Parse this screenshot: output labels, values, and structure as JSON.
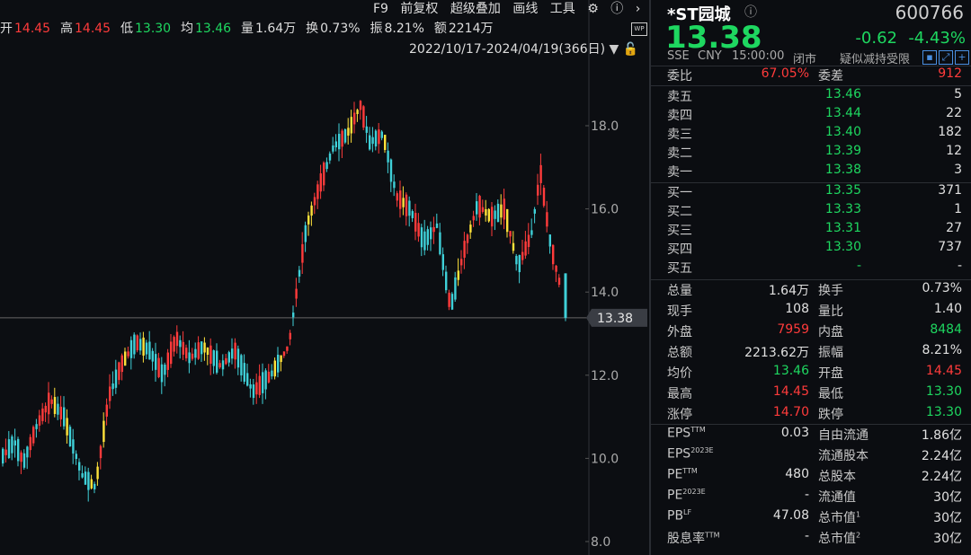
{
  "ohlc": {
    "open_label": "开",
    "open_value": "14.45",
    "high_label": "高",
    "high_value": "14.45",
    "low_label": "低",
    "low_value": "13.30",
    "avg_label": "均",
    "avg_value": "13.46",
    "volume_label": "量",
    "volume_value": "1.64万",
    "turnover_label": "换",
    "turnover_value": "0.73%",
    "amplitude_label": "振",
    "amplitude_value": "8.21%",
    "amount_label": "额",
    "amount_value": "2214万"
  },
  "menu": [
    "F9",
    "前复权",
    "超级叠加",
    "画线",
    "工具"
  ],
  "date_range": "2022/10/17-2024/04/19(366日)",
  "axis_ticks": [
    "18.0",
    "16.0",
    "14.0",
    "12.0",
    "10.0",
    "8.0"
  ],
  "current_price_label": "13.38",
  "stock": {
    "name": "*ST园城",
    "code": "600766",
    "price": "13.38",
    "change": "-0.62",
    "change_pct": "-4.43%",
    "exchange": "SSE",
    "currency": "CNY",
    "time": "15:00:00",
    "status": "闭市",
    "note": "疑似减持受限"
  },
  "committee": {
    "ratio_label": "委比",
    "ratio_value": "67.05%",
    "diff_label": "委差",
    "diff_value": "912"
  },
  "asks": [
    {
      "label": "卖五",
      "price": "13.46",
      "vol": "5"
    },
    {
      "label": "卖四",
      "price": "13.44",
      "vol": "22"
    },
    {
      "label": "卖三",
      "price": "13.40",
      "vol": "182"
    },
    {
      "label": "卖二",
      "price": "13.39",
      "vol": "12"
    },
    {
      "label": "卖一",
      "price": "13.38",
      "vol": "3"
    }
  ],
  "bids": [
    {
      "label": "买一",
      "price": "13.35",
      "vol": "371"
    },
    {
      "label": "买二",
      "price": "13.33",
      "vol": "1"
    },
    {
      "label": "买三",
      "price": "13.31",
      "vol": "27"
    },
    {
      "label": "买四",
      "price": "13.30",
      "vol": "737"
    },
    {
      "label": "买五",
      "price": "-",
      "vol": "-"
    }
  ],
  "stats": [
    {
      "l1": "总量",
      "v1": "1.64万",
      "c1": "white",
      "l2": "换手",
      "v2": "0.73%",
      "c2": "white"
    },
    {
      "l1": "现手",
      "v1": "108",
      "c1": "white",
      "l2": "量比",
      "v2": "1.40",
      "c2": "white"
    },
    {
      "l1": "外盘",
      "v1": "7959",
      "c1": "red",
      "l2": "内盘",
      "v2": "8484",
      "c2": "green"
    },
    {
      "l1": "总额",
      "v1": "2213.62万",
      "c1": "white",
      "l2": "振幅",
      "v2": "8.21%",
      "c2": "white"
    },
    {
      "l1": "均价",
      "v1": "13.46",
      "c1": "green",
      "l2": "开盘",
      "v2": "14.45",
      "c2": "red"
    },
    {
      "l1": "最高",
      "v1": "14.45",
      "c1": "red",
      "l2": "最低",
      "v2": "13.30",
      "c2": "green"
    },
    {
      "l1": "涨停",
      "v1": "14.70",
      "c1": "red",
      "l2": "跌停",
      "v2": "13.30",
      "c2": "green"
    }
  ],
  "fundamentals": [
    {
      "l1": "EPS",
      "s1": "TTM",
      "v1": "0.03",
      "l2": "自由流通",
      "s2": "",
      "v2": "1.86亿"
    },
    {
      "l1": "EPS",
      "s1": "2023E",
      "v1": "",
      "l2": "流通股本",
      "s2": "",
      "v2": "2.24亿"
    },
    {
      "l1": "PE",
      "s1": "TTM",
      "v1": "480",
      "l2": "总股本",
      "s2": "",
      "v2": "2.24亿"
    },
    {
      "l1": "PE",
      "s1": "2023E",
      "v1": "-",
      "l2": "流通值",
      "s2": "",
      "v2": "30亿"
    },
    {
      "l1": "PB",
      "s1": "LF",
      "v1": "47.08",
      "l2": "总市值",
      "s2": "1",
      "v2": "30亿"
    },
    {
      "l1": "股息率",
      "s1": "TTM",
      "v1": "-",
      "l2": "总市值",
      "s2": "2",
      "v2": "30亿"
    }
  ],
  "colors": {
    "up": "#ff3b3b",
    "down": "#1ed760",
    "accent": "#3fd0d8",
    "yellow": "#ffe23a"
  }
}
